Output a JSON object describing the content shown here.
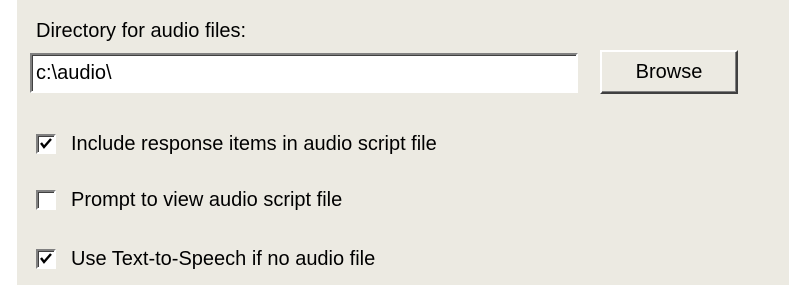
{
  "directory": {
    "label": "Directory for audio files:",
    "value": "c:\\audio\\"
  },
  "browse_button": {
    "label": "Browse"
  },
  "options": [
    {
      "label": "Include response items in audio script file",
      "checked": true
    },
    {
      "label": "Prompt to view audio script file",
      "checked": false
    },
    {
      "label": "Use Text-to-Speech if no audio file",
      "checked": true
    }
  ],
  "colors": {
    "panel_background": "#eceae2",
    "page_background": "#ffffff"
  }
}
